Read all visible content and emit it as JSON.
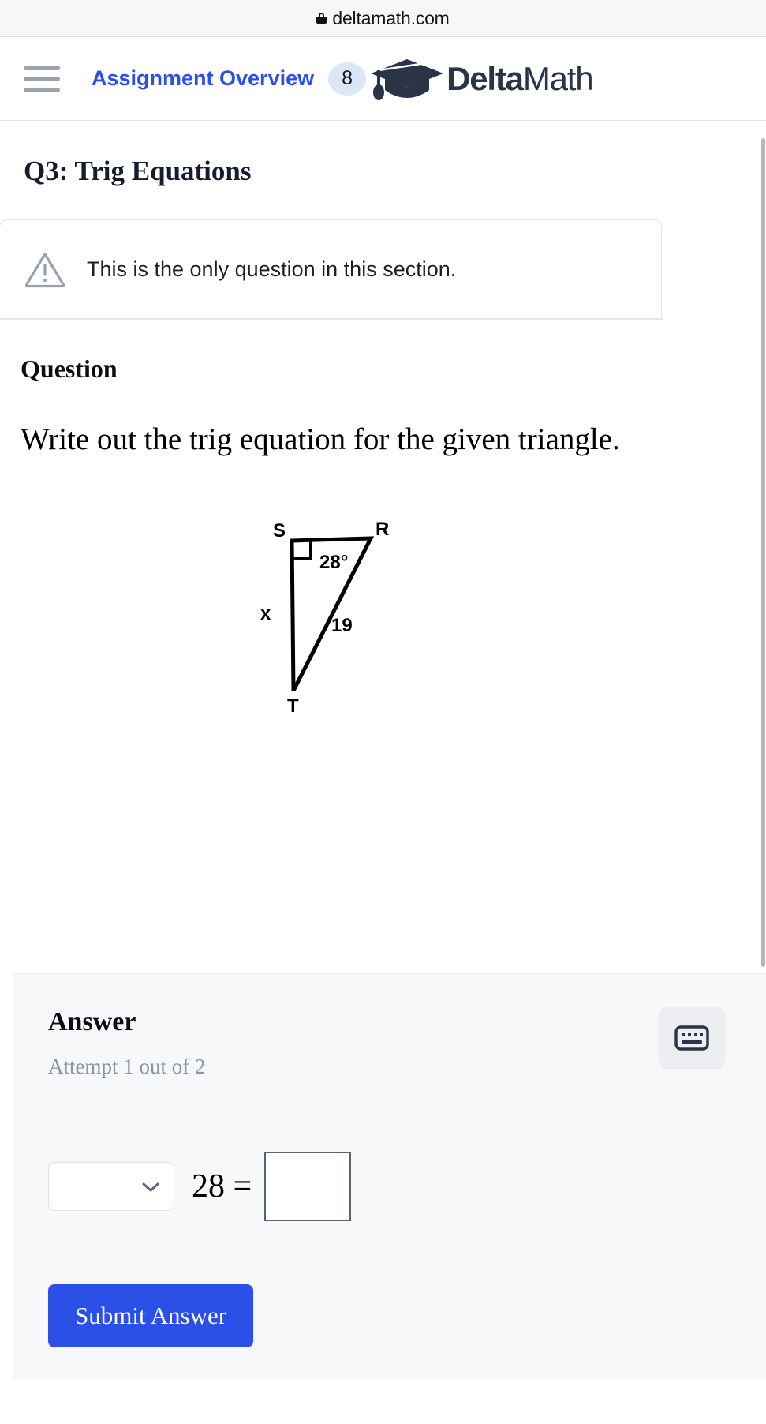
{
  "browser": {
    "url": "deltamath.com",
    "lock_icon": "lock-icon"
  },
  "header": {
    "menu_icon": "hamburger-menu-icon",
    "overview_link": "Assignment Overview",
    "badge_count": "8",
    "logo_icon": "graduation-cap-icon",
    "brand_bold": "Delta",
    "brand_light": "Math",
    "link_color": "#2b50e8",
    "badge_bg": "#dce6f7",
    "brand_color": "#2b3447"
  },
  "question": {
    "title": "Q3: Trig Equations",
    "alert_icon": "warning-triangle-icon",
    "alert_text": "This is the only question in this section.",
    "section_label": "Question",
    "prompt": "Write out the trig equation for the given triangle."
  },
  "figure": {
    "type": "right-triangle-diagram",
    "vertex_top_left": "S",
    "vertex_top_right": "R",
    "vertex_bottom": "T",
    "right_angle_at": "S",
    "angle_label": "28°",
    "side_left_label": "x",
    "side_hyp_label": "19"
  },
  "answer": {
    "title": "Answer",
    "attempt_text": "Attempt 1 out of 2",
    "keyboard_icon": "keyboard-icon",
    "function_select_value": "",
    "function_select_icon": "chevron-down-icon",
    "angle_value": "28",
    "equals_sign": "=",
    "result_input_value": "",
    "submit_label": "Submit Answer",
    "submit_color": "#2b50e8"
  }
}
